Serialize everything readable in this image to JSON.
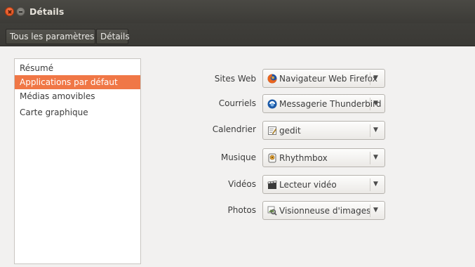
{
  "window": {
    "title": "Détails"
  },
  "breadcrumbs": [
    {
      "label": "Tous les paramètres"
    },
    {
      "label": "Détails"
    }
  ],
  "sidebar": {
    "items": [
      {
        "label": "Résumé",
        "selected": false
      },
      {
        "label": "Applications par défaut",
        "selected": true
      },
      {
        "label": "Médias amovibles",
        "selected": false
      },
      {
        "label": "Carte graphique",
        "selected": false
      }
    ]
  },
  "defaults": [
    {
      "label": "Sites Web",
      "value": "Navigateur Web Firefox",
      "icon": "firefox-icon"
    },
    {
      "label": "Courriels",
      "value": "Messagerie Thunderbird",
      "icon": "thunderbird-icon"
    },
    {
      "label": "Calendrier",
      "value": "gedit",
      "icon": "gedit-icon"
    },
    {
      "label": "Musique",
      "value": "Rhythmbox",
      "icon": "rhythmbox-icon"
    },
    {
      "label": "Vidéos",
      "value": "Lecteur vidéo",
      "icon": "video-player-icon"
    },
    {
      "label": "Photos",
      "value": "Visionneuse d'images",
      "icon": "image-viewer-icon"
    }
  ],
  "colors": {
    "selection": "#f07746",
    "titlebar": "#3c3b37",
    "background": "#f2f1f0"
  }
}
